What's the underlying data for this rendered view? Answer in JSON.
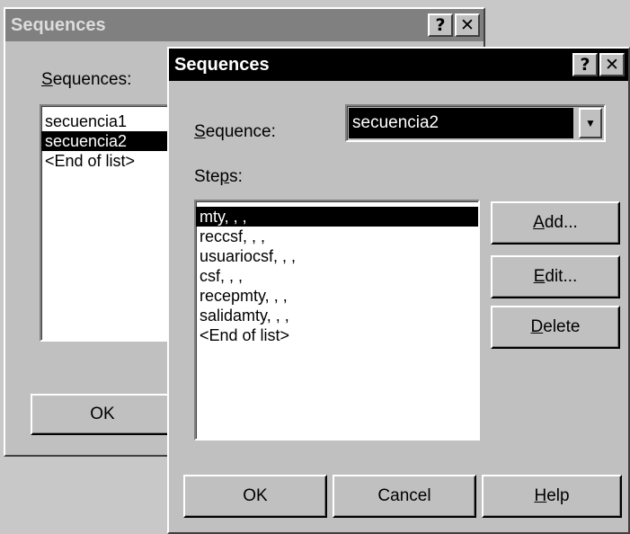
{
  "back_dialog": {
    "title": "Sequences",
    "help_glyph": "?",
    "close_glyph": "✕",
    "label_sequences_prefix": "",
    "label_sequences_mnemonic": "S",
    "label_sequences_rest": "equences:",
    "items": [
      "secuencia1",
      "secuencia2",
      "<End of list>"
    ],
    "selected_index": 1,
    "ok_label": "OK"
  },
  "front_dialog": {
    "title": "Sequences",
    "help_glyph": "?",
    "close_glyph": "✕",
    "label_sequence_mnemonic": "S",
    "label_sequence_rest": "equence:",
    "sequence_value": "secuencia2",
    "combo_arrow_glyph": "▼",
    "label_steps_pre": "Ste",
    "label_steps_mnemonic": "p",
    "label_steps_post": "s:",
    "steps": [
      "mty, , ,",
      "reccsf, , ,",
      "usuariocsf, , ,",
      "csf, , ,",
      "recepmty, , ,",
      "salidamty, , ,",
      "<End of list>"
    ],
    "selected_step_index": 0,
    "add_mnemonic": "A",
    "add_rest": "dd...",
    "edit_mnemonic": "E",
    "edit_rest": "dit...",
    "delete_mnemonic": "D",
    "delete_rest": "elete",
    "ok_label": "OK",
    "cancel_label": "Cancel",
    "help_mnemonic": "H",
    "help_rest": "elp"
  },
  "colors": {
    "dialog_face": "#c0c0c0",
    "active_title": "#000000",
    "inactive_title": "#808080",
    "desktop": "#c8c8c8"
  }
}
